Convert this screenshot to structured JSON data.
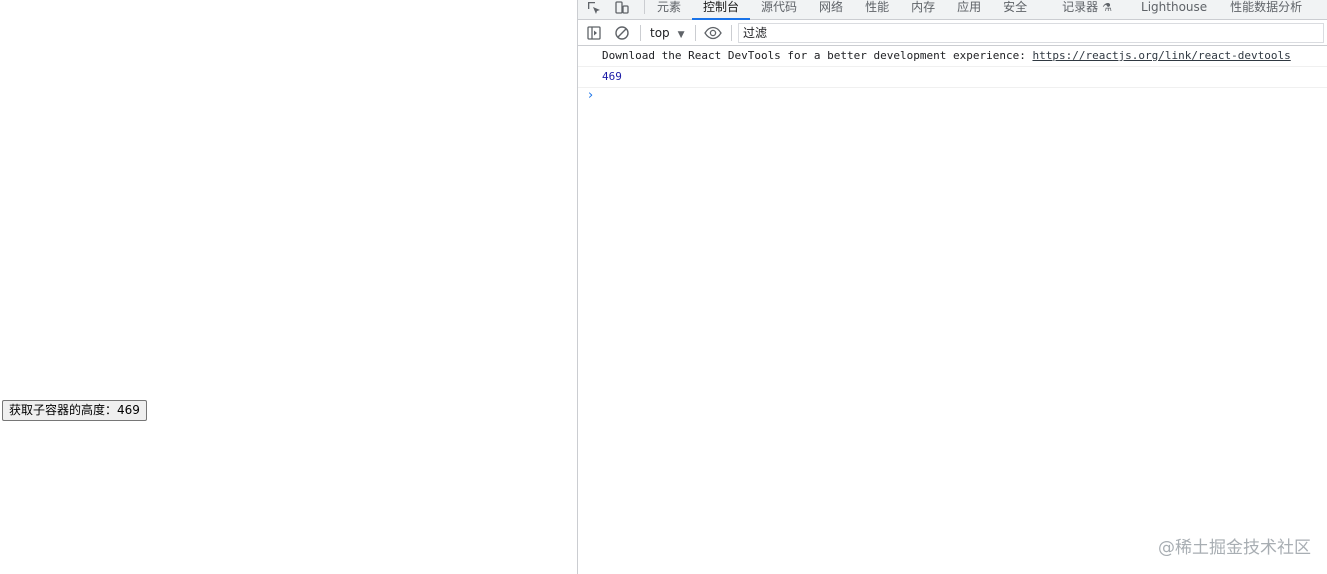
{
  "page": {
    "button_label": "获取子容器的高度：469"
  },
  "devtools": {
    "tabs": [
      {
        "label": "元素",
        "active": false
      },
      {
        "label": "控制台",
        "active": true
      },
      {
        "label": "源代码",
        "active": false
      },
      {
        "label": "网络",
        "active": false
      },
      {
        "label": "性能",
        "active": false
      },
      {
        "label": "内存",
        "active": false
      },
      {
        "label": "应用",
        "active": false
      },
      {
        "label": "安全",
        "active": false
      },
      {
        "label": "记录器",
        "active": false
      },
      {
        "label": "Lighthouse",
        "active": false
      },
      {
        "label": "性能数据分析",
        "active": false
      }
    ],
    "toolbar": {
      "context": "top",
      "filter_placeholder": "过滤"
    },
    "console": {
      "message_text": "Download the React DevTools for a better development experience: ",
      "message_link": "https://reactjs.org/link/react-devtools",
      "log_value": "469",
      "prompt_glyph": "›"
    },
    "icons": {
      "inspect": "inspect-element-icon",
      "device": "device-toolbar-icon",
      "sidebar": "show-sidebar-icon",
      "clear": "clear-console-icon",
      "eye": "live-expression-eye-icon",
      "flask": "experimental-flask-icon"
    }
  },
  "watermark": "@稀土掘金技术社区",
  "colors": {
    "accent": "#1a73e8",
    "number": "#1a1aa6",
    "toolbar_bg": "#f1f3f4"
  }
}
